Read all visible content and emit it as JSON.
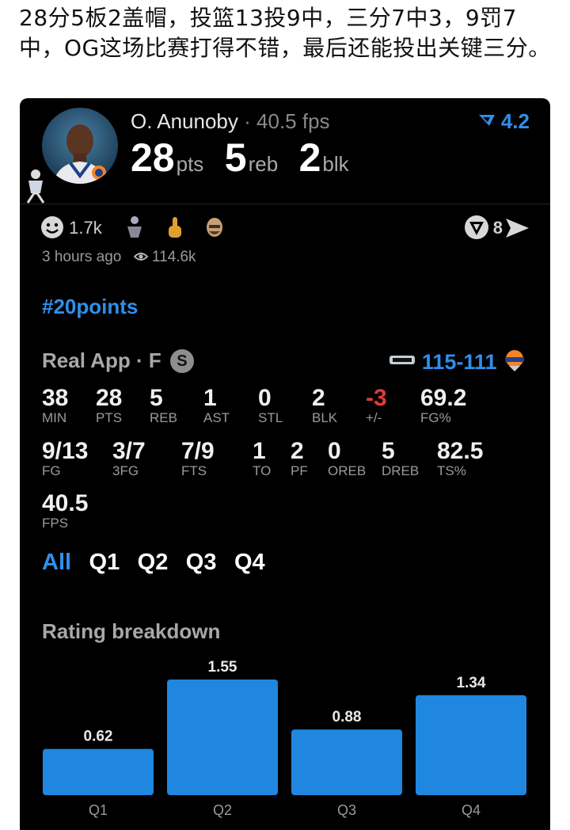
{
  "post": {
    "text": "28分5板2盖帽，投篮13投9中，三分7中3，9罚7中，OG这场比赛打得不错，最后还能投出关键三分。"
  },
  "card": {
    "player_name": "O. Anunoby",
    "separator": "·",
    "fps_text": "40.5 fps",
    "rating": "4.2",
    "big_stats": [
      {
        "value": "28",
        "unit": "pts"
      },
      {
        "value": "5",
        "unit": "reb"
      },
      {
        "value": "2",
        "unit": "blk"
      }
    ],
    "reactions_count": "1.7k",
    "comments_count": "8",
    "time_ago": "3 hours ago",
    "views": "114.6k",
    "hashtag": "#20points",
    "app_line": "Real App · F",
    "badge": "S",
    "score": "115-111",
    "stats_row1": [
      {
        "v": "38",
        "l": "MIN"
      },
      {
        "v": "28",
        "l": "PTS"
      },
      {
        "v": "5",
        "l": "REB"
      },
      {
        "v": "1",
        "l": "AST"
      },
      {
        "v": "0",
        "l": "STL"
      },
      {
        "v": "2",
        "l": "BLK"
      },
      {
        "v": "-3",
        "l": "+/-"
      },
      {
        "v": "69.2",
        "l": "FG%"
      }
    ],
    "stats_row2": [
      {
        "v": "9/13",
        "l": "FG"
      },
      {
        "v": "3/7",
        "l": "3FG"
      },
      {
        "v": "7/9",
        "l": "FTS"
      },
      {
        "v": "1",
        "l": "TO"
      },
      {
        "v": "2",
        "l": "PF"
      },
      {
        "v": "0",
        "l": "OREB"
      },
      {
        "v": "5",
        "l": "DREB"
      },
      {
        "v": "82.5",
        "l": "TS%"
      }
    ],
    "stats_row3": [
      {
        "v": "40.5",
        "l": "FPS"
      }
    ],
    "tabs": [
      "All",
      "Q1",
      "Q2",
      "Q3",
      "Q4"
    ],
    "active_tab": "All",
    "rating_breakdown_title": "Rating breakdown",
    "colors": {
      "accent": "#2f8fea",
      "negative": "#e23a3a",
      "bar": "#1f87e0"
    }
  },
  "chart_data": {
    "type": "bar",
    "categories": [
      "Q1",
      "Q2",
      "Q3",
      "Q4"
    ],
    "values": [
      0.62,
      1.55,
      0.88,
      1.34
    ],
    "title": "Rating breakdown",
    "xlabel": "",
    "ylabel": "",
    "ylim": [
      0,
      1.55
    ],
    "grid": false,
    "data_labels": true
  }
}
